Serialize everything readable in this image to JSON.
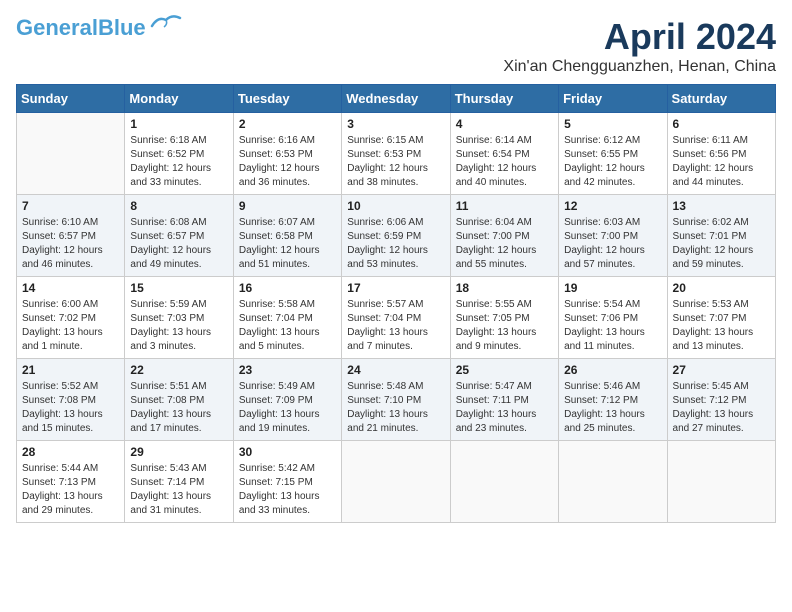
{
  "logo": {
    "line1": "General",
    "line2": "Blue"
  },
  "title": "April 2024",
  "location": "Xin'an Chengguanzhen, Henan, China",
  "weekdays": [
    "Sunday",
    "Monday",
    "Tuesday",
    "Wednesday",
    "Thursday",
    "Friday",
    "Saturday"
  ],
  "weeks": [
    [
      {
        "day": "",
        "details": []
      },
      {
        "day": "1",
        "details": [
          "Sunrise: 6:18 AM",
          "Sunset: 6:52 PM",
          "Daylight: 12 hours",
          "and 33 minutes."
        ]
      },
      {
        "day": "2",
        "details": [
          "Sunrise: 6:16 AM",
          "Sunset: 6:53 PM",
          "Daylight: 12 hours",
          "and 36 minutes."
        ]
      },
      {
        "day": "3",
        "details": [
          "Sunrise: 6:15 AM",
          "Sunset: 6:53 PM",
          "Daylight: 12 hours",
          "and 38 minutes."
        ]
      },
      {
        "day": "4",
        "details": [
          "Sunrise: 6:14 AM",
          "Sunset: 6:54 PM",
          "Daylight: 12 hours",
          "and 40 minutes."
        ]
      },
      {
        "day": "5",
        "details": [
          "Sunrise: 6:12 AM",
          "Sunset: 6:55 PM",
          "Daylight: 12 hours",
          "and 42 minutes."
        ]
      },
      {
        "day": "6",
        "details": [
          "Sunrise: 6:11 AM",
          "Sunset: 6:56 PM",
          "Daylight: 12 hours",
          "and 44 minutes."
        ]
      }
    ],
    [
      {
        "day": "7",
        "details": [
          "Sunrise: 6:10 AM",
          "Sunset: 6:57 PM",
          "Daylight: 12 hours",
          "and 46 minutes."
        ]
      },
      {
        "day": "8",
        "details": [
          "Sunrise: 6:08 AM",
          "Sunset: 6:57 PM",
          "Daylight: 12 hours",
          "and 49 minutes."
        ]
      },
      {
        "day": "9",
        "details": [
          "Sunrise: 6:07 AM",
          "Sunset: 6:58 PM",
          "Daylight: 12 hours",
          "and 51 minutes."
        ]
      },
      {
        "day": "10",
        "details": [
          "Sunrise: 6:06 AM",
          "Sunset: 6:59 PM",
          "Daylight: 12 hours",
          "and 53 minutes."
        ]
      },
      {
        "day": "11",
        "details": [
          "Sunrise: 6:04 AM",
          "Sunset: 7:00 PM",
          "Daylight: 12 hours",
          "and 55 minutes."
        ]
      },
      {
        "day": "12",
        "details": [
          "Sunrise: 6:03 AM",
          "Sunset: 7:00 PM",
          "Daylight: 12 hours",
          "and 57 minutes."
        ]
      },
      {
        "day": "13",
        "details": [
          "Sunrise: 6:02 AM",
          "Sunset: 7:01 PM",
          "Daylight: 12 hours",
          "and 59 minutes."
        ]
      }
    ],
    [
      {
        "day": "14",
        "details": [
          "Sunrise: 6:00 AM",
          "Sunset: 7:02 PM",
          "Daylight: 13 hours",
          "and 1 minute."
        ]
      },
      {
        "day": "15",
        "details": [
          "Sunrise: 5:59 AM",
          "Sunset: 7:03 PM",
          "Daylight: 13 hours",
          "and 3 minutes."
        ]
      },
      {
        "day": "16",
        "details": [
          "Sunrise: 5:58 AM",
          "Sunset: 7:04 PM",
          "Daylight: 13 hours",
          "and 5 minutes."
        ]
      },
      {
        "day": "17",
        "details": [
          "Sunrise: 5:57 AM",
          "Sunset: 7:04 PM",
          "Daylight: 13 hours",
          "and 7 minutes."
        ]
      },
      {
        "day": "18",
        "details": [
          "Sunrise: 5:55 AM",
          "Sunset: 7:05 PM",
          "Daylight: 13 hours",
          "and 9 minutes."
        ]
      },
      {
        "day": "19",
        "details": [
          "Sunrise: 5:54 AM",
          "Sunset: 7:06 PM",
          "Daylight: 13 hours",
          "and 11 minutes."
        ]
      },
      {
        "day": "20",
        "details": [
          "Sunrise: 5:53 AM",
          "Sunset: 7:07 PM",
          "Daylight: 13 hours",
          "and 13 minutes."
        ]
      }
    ],
    [
      {
        "day": "21",
        "details": [
          "Sunrise: 5:52 AM",
          "Sunset: 7:08 PM",
          "Daylight: 13 hours",
          "and 15 minutes."
        ]
      },
      {
        "day": "22",
        "details": [
          "Sunrise: 5:51 AM",
          "Sunset: 7:08 PM",
          "Daylight: 13 hours",
          "and 17 minutes."
        ]
      },
      {
        "day": "23",
        "details": [
          "Sunrise: 5:49 AM",
          "Sunset: 7:09 PM",
          "Daylight: 13 hours",
          "and 19 minutes."
        ]
      },
      {
        "day": "24",
        "details": [
          "Sunrise: 5:48 AM",
          "Sunset: 7:10 PM",
          "Daylight: 13 hours",
          "and 21 minutes."
        ]
      },
      {
        "day": "25",
        "details": [
          "Sunrise: 5:47 AM",
          "Sunset: 7:11 PM",
          "Daylight: 13 hours",
          "and 23 minutes."
        ]
      },
      {
        "day": "26",
        "details": [
          "Sunrise: 5:46 AM",
          "Sunset: 7:12 PM",
          "Daylight: 13 hours",
          "and 25 minutes."
        ]
      },
      {
        "day": "27",
        "details": [
          "Sunrise: 5:45 AM",
          "Sunset: 7:12 PM",
          "Daylight: 13 hours",
          "and 27 minutes."
        ]
      }
    ],
    [
      {
        "day": "28",
        "details": [
          "Sunrise: 5:44 AM",
          "Sunset: 7:13 PM",
          "Daylight: 13 hours",
          "and 29 minutes."
        ]
      },
      {
        "day": "29",
        "details": [
          "Sunrise: 5:43 AM",
          "Sunset: 7:14 PM",
          "Daylight: 13 hours",
          "and 31 minutes."
        ]
      },
      {
        "day": "30",
        "details": [
          "Sunrise: 5:42 AM",
          "Sunset: 7:15 PM",
          "Daylight: 13 hours",
          "and 33 minutes."
        ]
      },
      {
        "day": "",
        "details": []
      },
      {
        "day": "",
        "details": []
      },
      {
        "day": "",
        "details": []
      },
      {
        "day": "",
        "details": []
      }
    ]
  ]
}
